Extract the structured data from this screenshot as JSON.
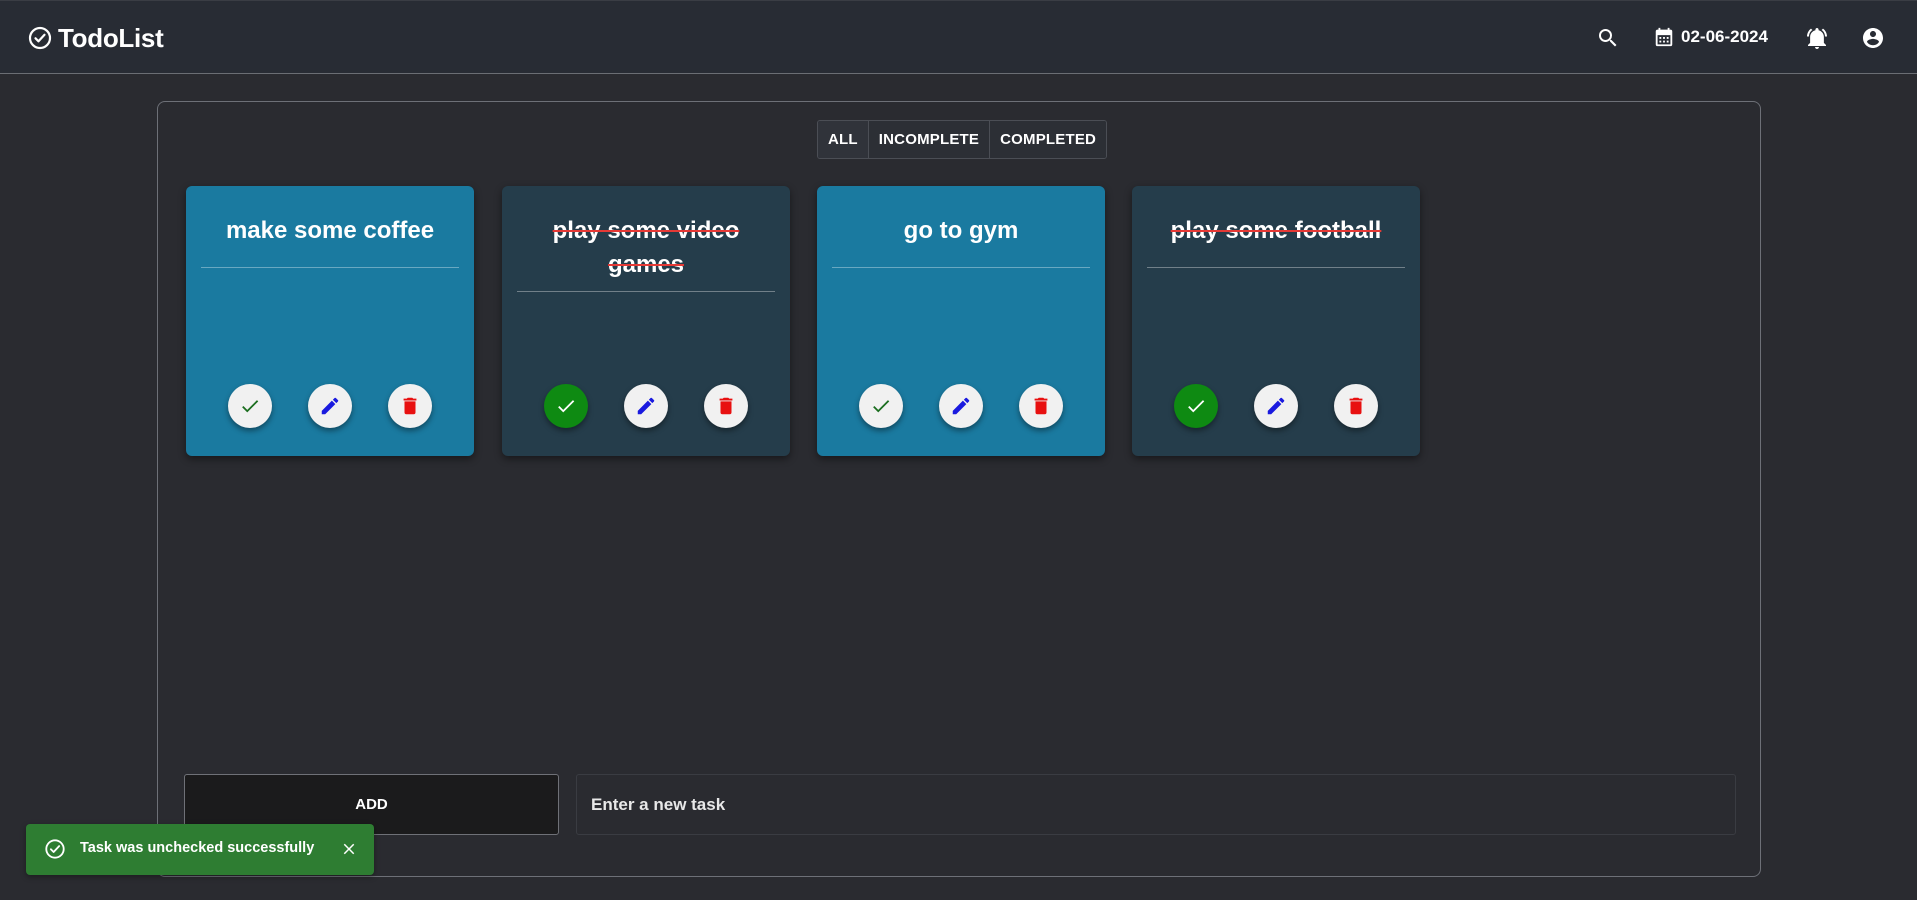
{
  "app": {
    "title": "TodoList"
  },
  "header": {
    "date": "02-06-2024",
    "icons": [
      "search-icon",
      "calendar-icon",
      "bell-icon",
      "user-icon"
    ]
  },
  "filters": {
    "items": [
      {
        "label": "ALL",
        "active": true
      },
      {
        "label": "INCOMPLETE",
        "active": false
      },
      {
        "label": "COMPLETED",
        "active": false
      }
    ]
  },
  "tasks": [
    {
      "title": "make some coffee",
      "completed": false
    },
    {
      "title": "play some video games",
      "completed": true
    },
    {
      "title": "go to gym",
      "completed": false
    },
    {
      "title": "play some football",
      "completed": true
    }
  ],
  "composer": {
    "add_label": "ADD",
    "placeholder": "Enter a new task",
    "value": ""
  },
  "toast": {
    "message": "Task was unchecked successfully",
    "type": "success"
  },
  "colors": {
    "background": "#2a2b30",
    "header": "#282c34",
    "card_incomplete": "#1a7aa0",
    "card_completed": "#253d4b",
    "check_done": "#0e8a12",
    "edit_icon": "#1a1adf",
    "delete_icon": "#e81010",
    "toast": "#2e7d32",
    "strike": "#e53935"
  }
}
